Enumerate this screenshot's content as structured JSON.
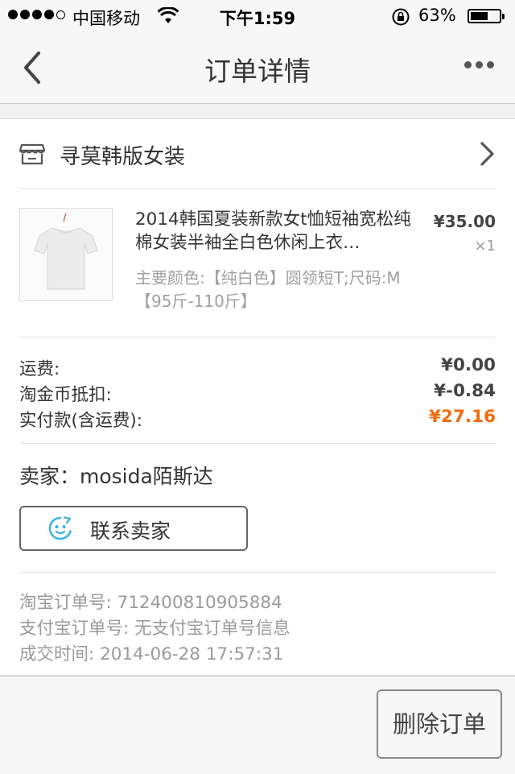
{
  "status_bar": {
    "carrier": "中国移动",
    "time": "下午1:59",
    "battery_percent": "63%",
    "battery_level": 0.63,
    "signal_bars_filled": 4,
    "signal_bars_total": 5,
    "icons": [
      "signal-dots-icon",
      "wifi-icon",
      "rotation-lock-icon",
      "battery-icon"
    ]
  },
  "nav": {
    "title": "订单详情",
    "back_icon": "back-chevron-icon",
    "more_icon": "more-dots-icon"
  },
  "shop": {
    "icon": "store-icon",
    "name": "寻莫韩版女装"
  },
  "product": {
    "title": "2014韩国夏装新款女t恤短袖宽松纯棉女装半袖全白色休闲上衣…",
    "spec": "主要颜色:【纯白色】圆领短T;尺码:M【95斤-110斤】",
    "price": "¥35.00",
    "quantity": "×1",
    "thumbnail": "white-tshirt-image"
  },
  "fees": [
    {
      "label": "运费:",
      "value": "¥0.00"
    },
    {
      "label": "淘金币抵扣:",
      "value": "¥-0.84"
    },
    {
      "label": "实付款(含运费):",
      "value": "¥27.16"
    }
  ],
  "seller": {
    "line": "卖家：mosida陌斯达",
    "contact_label": "联系卖家",
    "contact_icon": "chat-face-icon"
  },
  "order_info": [
    "淘宝订单号: 712400810905884",
    "支付宝订单号: 无支付宝订单号信息",
    "成交时间: 2014-06-28 17:57:31"
  ],
  "actions": {
    "delete_label": "删除订单"
  },
  "colors": {
    "accent_total": "#f36b0b",
    "chat_icon": "#3bb3e6",
    "muted_text": "#9a9a9a"
  }
}
